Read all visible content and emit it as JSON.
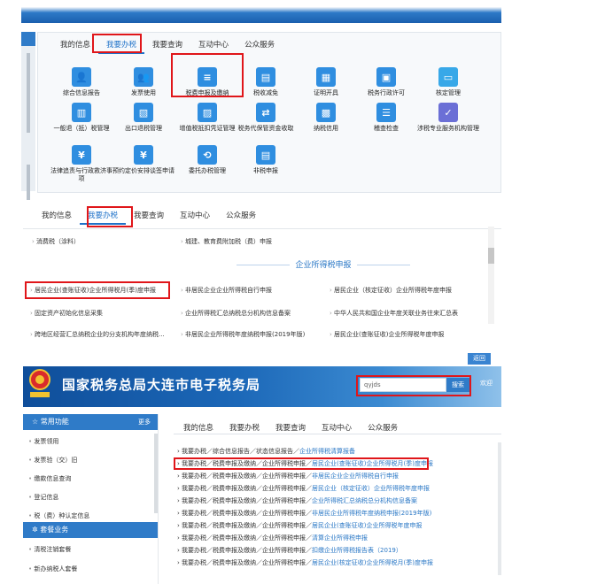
{
  "colors": {
    "accent": "#1f72c9",
    "highlight": "#e0161a"
  },
  "panel1": {
    "tabs": [
      "我的信息",
      "我要办税",
      "我要查询",
      "互动中心",
      "公众服务"
    ],
    "items": [
      {
        "label": "综合信息报告",
        "icon": "user-card-icon"
      },
      {
        "label": "发票使用",
        "icon": "users-icon"
      },
      {
        "label": "税费申报及缴纳",
        "icon": "tax-declaration-icon"
      },
      {
        "label": "税收减免",
        "icon": "document-icon"
      },
      {
        "label": "证明开具",
        "icon": "certificate-icon"
      },
      {
        "label": "税务行政许可",
        "icon": "permit-icon"
      },
      {
        "label": "核定管理",
        "icon": "monitor-icon"
      },
      {
        "label": "一般退（抵）税管理",
        "icon": "refund-doc-icon"
      },
      {
        "label": "出口退税管理",
        "icon": "export-refund-icon"
      },
      {
        "label": "增值税抵扣凭证管理",
        "icon": "voucher-icon"
      },
      {
        "label": "税务代保管资金收取",
        "icon": "fund-icon"
      },
      {
        "label": "纳税信用",
        "icon": "credit-icon"
      },
      {
        "label": "稽查检查",
        "icon": "inspection-icon"
      },
      {
        "label": "涉税专业服务机构管理",
        "icon": "check-icon"
      },
      {
        "label": "法律追责与行政救济事项",
        "icon": "legal-icon"
      },
      {
        "label": "预约定价安排谈签申请",
        "icon": "pricing-icon"
      },
      {
        "label": "委托办税管理",
        "icon": "clock-icon"
      },
      {
        "label": "非税申报",
        "icon": "nontax-icon"
      }
    ]
  },
  "panel2": {
    "tabs": [
      "我的信息",
      "我要办税",
      "我要查询",
      "互动中心",
      "公众服务"
    ],
    "top_links": [
      "消费税（涂料）",
      "城建、教育费附加税（费）申报"
    ],
    "section_title": "企业所得税申报",
    "links": [
      "居民企业(查账征收)企业所得税月(季)度申报",
      "非居民企业企业所得税自行申报",
      "居民企业（核定征收）企业所得税年度申报",
      "固定资产初始化信息采集",
      "企业所得税汇总纳税总分机构信息备案",
      "中华人民共和国企业年度关联业务往来汇总表",
      "跨地区经营汇总纳税企业的分支机构年度纳税...",
      "非居民企业所得税年度纳税申报(2019年版)",
      "居民企业(查账征收)企业所得税年度申报"
    ],
    "close_label": "返回"
  },
  "panel3": {
    "site_title": "国家税务总局大连市电子税务局",
    "search_value": "qyjds",
    "search_button": "搜索",
    "login": "欢迎",
    "side_header": "常用功能",
    "side_more": "更多",
    "side_items": [
      "发票领用",
      "发票验（交）旧",
      "缴款信息查询",
      "登记信息",
      "税（费）种认定信息"
    ],
    "side_header2": "套餐业务",
    "side_items2": [
      "清税注销套餐",
      "新办纳税人套餐"
    ],
    "tabs": [
      "我的信息",
      "我要办税",
      "我要查询",
      "互动中心",
      "公众服务"
    ],
    "results": [
      {
        "path": "我要办税／综合信息报告／状态信息报告／",
        "hl": "企业所得税清算报备"
      },
      {
        "path": "我要办税／税费申报及缴纳／企业所得税申报／",
        "hl": "居民企业(查账征收)企业所得税月(季)度申报"
      },
      {
        "path": "我要办税／税费申报及缴纳／企业所得税申报／",
        "hl": "非居民企业企业所得税自行申报"
      },
      {
        "path": "我要办税／税费申报及缴纳／企业所得税申报／",
        "hl": "居民企业（核定征收）企业所得税年度申报"
      },
      {
        "path": "我要办税／税费申报及缴纳／企业所得税申报／",
        "hl": "企业所得税汇总纳税总分机构信息备案"
      },
      {
        "path": "我要办税／税费申报及缴纳／企业所得税申报／",
        "hl": "非居民企业所得税年度纳税申报(2019年版)"
      },
      {
        "path": "我要办税／税费申报及缴纳／企业所得税申报／",
        "hl": "居民企业(查账征收)企业所得税年度申报"
      },
      {
        "path": "我要办税／税费申报及缴纳／企业所得税申报／",
        "hl": "清算企业所得税申报"
      },
      {
        "path": "我要办税／税费申报及缴纳／企业所得税申报／",
        "hl": "扣缴企业所得税报告表（2019）"
      },
      {
        "path": "我要办税／税费申报及缴纳／企业所得税申报／",
        "hl": "居民企业(核定征收)企业所得税月(季)度申报"
      }
    ]
  }
}
